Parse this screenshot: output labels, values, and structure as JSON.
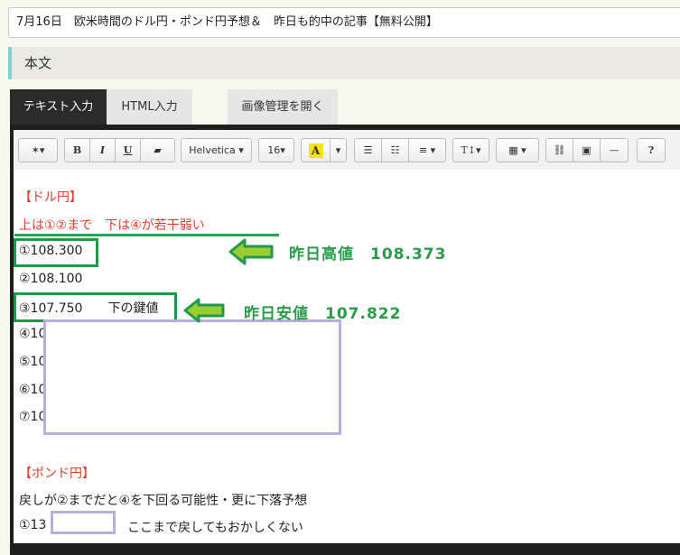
{
  "title_field": {
    "value": "7月16日　欧米時間のドル円・ポンド円予想＆　昨日も的中の記事【無料公開】"
  },
  "section": {
    "label": "本文"
  },
  "tabs": [
    {
      "label": "テキスト入力",
      "active": true
    },
    {
      "label": "HTML入力",
      "active": false
    },
    {
      "label": "画像管理を開く",
      "active": false
    }
  ],
  "toolbar": {
    "magic": "✶▾",
    "bold": "B",
    "italic": "I",
    "underline": "U",
    "eraser": "▰",
    "font_family": "Helvetica ▾",
    "font_size": "16▾",
    "highlight": "A",
    "color_dropdown": "▾",
    "bullet_list": "☰",
    "number_list": "☷",
    "align": "≡ ▾",
    "line_height": "T↕▾",
    "table": "▦ ▾",
    "link": "⛓",
    "picture": "▣",
    "hr": "—",
    "help": "?"
  },
  "content": {
    "dollar_header": "【ドル円】",
    "dollar_note": "上は①②まで　下は④が若干弱い",
    "row1": "①108.300",
    "row2": "②108.100",
    "row3": "③107.750　　下の鍵値",
    "row4": "④10",
    "row5": "⑤10",
    "row6": "⑥10",
    "row7": "⑦10",
    "pound_header": "【ポンド円】",
    "pound_note": "戻しが②までだと④を下回る可能性・更に下落予想",
    "pound_row1": "①13",
    "pound_row1_comment": "ここまで戻してもおかしくない"
  },
  "annotations": {
    "high": "昨日高値　108.373",
    "low": "昨日安値　107.822"
  },
  "colors": {
    "annotation_green": "#2a9b49",
    "box_green": "#1f9a4a",
    "arrow_fill": "#9acd32",
    "mask_lavender": "#b7aedd",
    "header_red": "#e53a2b"
  }
}
